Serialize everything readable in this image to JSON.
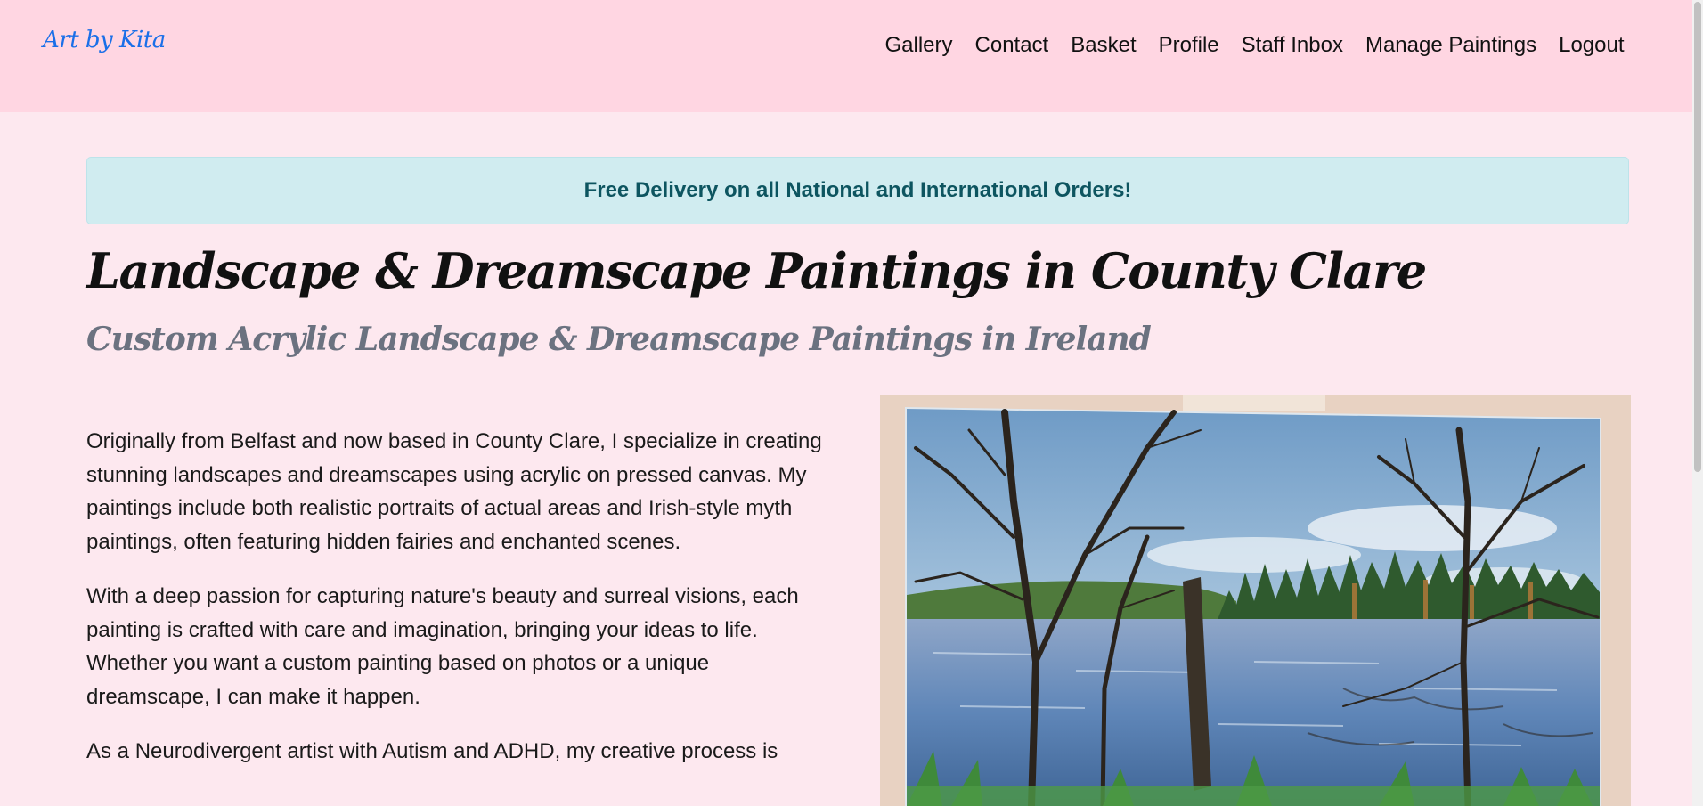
{
  "brand": "Art by Kita",
  "nav": {
    "items": [
      "Gallery",
      "Contact",
      "Basket",
      "Profile",
      "Staff Inbox",
      "Manage Paintings",
      "Logout"
    ]
  },
  "banner": "Free Delivery on all National and International Orders!",
  "headline": "Landscape & Dreamscape Paintings in County Clare",
  "subheadline": "Custom Acrylic Landscape & Dreamscape Paintings in Ireland",
  "paragraphs": [
    "Originally from Belfast and now based in County Clare, I specialize in creating stunning landscapes and dreamscapes using acrylic on pressed canvas. My paintings include both realistic portraits of actual areas and Irish-style myth paintings, often featuring hidden fairies and enchanted scenes.",
    "With a deep passion for capturing nature's beauty and surreal visions, each painting is crafted with care and imagination, bringing your ideas to life. Whether you want a custom painting based on photos or a unique dreamscape, I can make it happen.",
    "As a Neurodivergent artist with Autism and ADHD, my creative process is"
  ],
  "colors": {
    "navbar_bg": "#ffd6e2",
    "page_bg": "#fde8ef",
    "brand": "#1a6fe8",
    "banner_bg": "#d0ecf0",
    "banner_text": "#0d5560",
    "subheadline": "#6b7280"
  }
}
